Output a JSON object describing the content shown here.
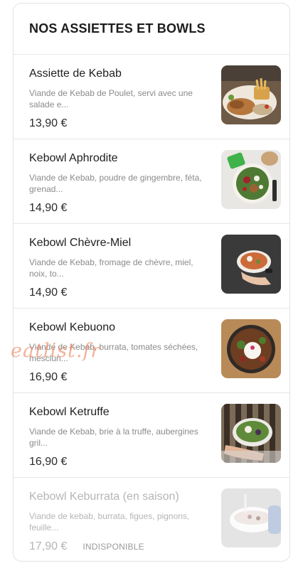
{
  "section": {
    "title": "NOS ASSIETTES ET BOWLS"
  },
  "items": [
    {
      "name": "Assiette de Kebab",
      "description": "Viande de Kebab de Poulet, servi avec une salade e...",
      "price": "13,90 €",
      "status": "",
      "image_icon": "kebab-plate-photo"
    },
    {
      "name": "Kebowl Aphrodite",
      "description": "Viande de Kebab, poudre de gingembre, féta, grenad...",
      "price": "14,90 €",
      "status": "",
      "image_icon": "bowl-photo"
    },
    {
      "name": "Kebowl Chèvre-Miel",
      "description": "Viande de Kebab, fromage de chèvre, miel, noix, to...",
      "price": "14,90 €",
      "status": "",
      "image_icon": "bowl-photo"
    },
    {
      "name": "Kebowl Kebuono",
      "description": "Viande de Kebab, burrata, tomates séchées, mesclun...",
      "price": "16,90 €",
      "status": "",
      "image_icon": "bowl-photo"
    },
    {
      "name": "Kebowl Ketruffe",
      "description": "Viande de Kebab, brie à la truffe, aubergines gril...",
      "price": "16,90 €",
      "status": "",
      "image_icon": "bowl-photo"
    },
    {
      "name": "Kebowl Keburrata (en saison)",
      "description": "Viande de kebab, burrata, figues, pignons, feuille...",
      "price": "17,90 €",
      "status": "INDISPONIBLE",
      "image_icon": "bowl-photo"
    }
  ],
  "watermark": "eatlist.fr",
  "colors": {
    "border": "#e3e3e3",
    "text": "#1e1e1e",
    "muted": "#8a8a8a",
    "watermark": "#eb825a"
  }
}
